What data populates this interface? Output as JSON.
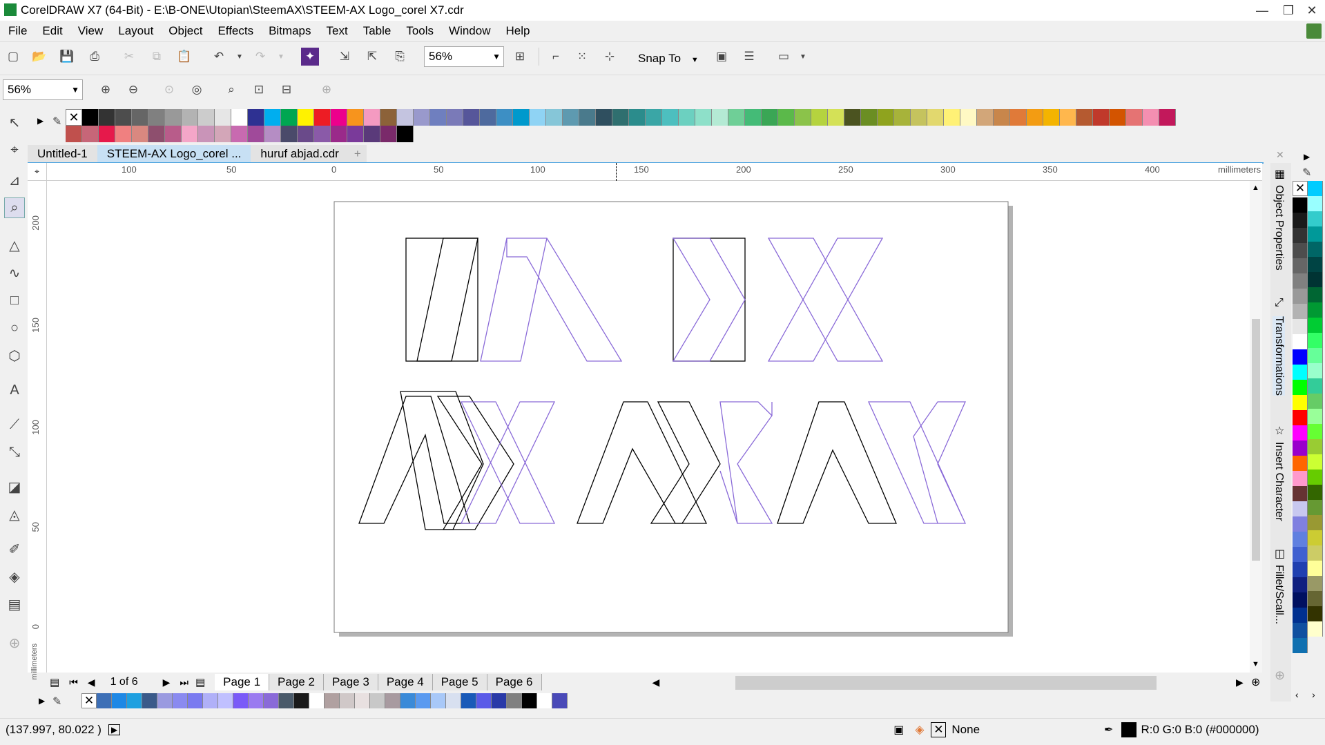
{
  "titlebar": {
    "title": "CorelDRAW X7 (64-Bit) - E:\\B-ONE\\Utopian\\SteemAX\\STEEM-AX Logo_corel X7.cdr",
    "minimize": "—",
    "restore": "❐",
    "close": "✕"
  },
  "menu": [
    "File",
    "Edit",
    "View",
    "Layout",
    "Object",
    "Effects",
    "Bitmaps",
    "Text",
    "Table",
    "Tools",
    "Window",
    "Help"
  ],
  "toolbar1": {
    "zoom_value": "56%",
    "snap_label": "Snap To"
  },
  "toolbar2": {
    "zoom_value": "56%"
  },
  "doc_tabs": [
    "Untitled-1",
    "STEEM-AX Logo_corel ...",
    "huruf abjad.cdr"
  ],
  "ruler_h": {
    "unit": "millimeters",
    "ticks": [
      "100",
      "50",
      "0",
      "50",
      "100",
      "150",
      "200",
      "250",
      "300",
      "350",
      "400"
    ]
  },
  "ruler_v": {
    "unit": "millimeters",
    "ticks": [
      "200",
      "150",
      "100",
      "50",
      "0"
    ]
  },
  "page_nav": {
    "counter": "1 of 6",
    "pages": [
      "Page 1",
      "Page 2",
      "Page 3",
      "Page 4",
      "Page 5",
      "Page 6"
    ]
  },
  "status": {
    "coords": "(137.997, 80.022 )",
    "fill_label": "None",
    "outline_label": "R:0 G:0 B:0 (#000000)"
  },
  "dockers": [
    "Object Properties",
    "Transformations",
    "Insert Character",
    "Fillet/Scall..."
  ],
  "colors": {
    "top_row1": [
      "#000000",
      "#333333",
      "#4d4d4d",
      "#666666",
      "#808080",
      "#999999",
      "#b3b3b3",
      "#cccccc",
      "#e6e6e6",
      "#ffffff",
      "#2e3192",
      "#00aeef",
      "#00a651",
      "#fff200",
      "#ed1c24",
      "#ec008c",
      "#f7941d",
      "#f49ac1",
      "#8c6239",
      "#c4c4e0",
      "#9999cc",
      "#6f7fbf",
      "#7a7ab8",
      "#56569a",
      "#4e6a9e",
      "#3d8fc4",
      "#0099cc",
      "#8fd3f4",
      "#86c6d8",
      "#5e9ab0",
      "#4a7a8c",
      "#2f4f5f",
      "#2f6f6f",
      "#2b8c8c",
      "#3aa6a6",
      "#4dbfbf",
      "#6cd0c0",
      "#8ee0c9",
      "#b4ead4",
      "#6fcf97",
      "#44bb77",
      "#3aa655",
      "#5bb94a",
      "#8bc34a",
      "#b5d33f",
      "#d4e157",
      "#4b5320",
      "#6b8e23",
      "#8fa31e",
      "#a7b33a",
      "#c5c35e",
      "#e2d86e",
      "#fff176",
      "#fff9c4",
      "#d2a679",
      "#c8864b",
      "#e07a39",
      "#f39c12",
      "#f4b400",
      "#ffb74d",
      "#b55a30",
      "#c0392b",
      "#d35400",
      "#e57373",
      "#f48fb1",
      "#c2185b"
    ],
    "top_row2": [
      "#c0504d",
      "#c76678",
      "#e6194b",
      "#f08080",
      "#d98880",
      "#8e4f6e",
      "#b85c8a",
      "#f4a6c8",
      "#c994b8",
      "#d3a6b8",
      "#c86ab0",
      "#a04a9a",
      "#b58dc4",
      "#4a4a6a",
      "#6a4a8a",
      "#8a5aa8",
      "#9a2a8a",
      "#7a3a9a",
      "#5a3a7a",
      "#7a2a6a",
      "#000000"
    ],
    "bottom": [
      "#3d6fb6",
      "#1e88e5",
      "#1ea0e0",
      "#3a5a8a",
      "#9a9ae0",
      "#8a8af0",
      "#7a7af0",
      "#b0b0f8",
      "#c0c0ff",
      "#7a5af8",
      "#9a7af0",
      "#8a6ad8",
      "#4a5a6a",
      "#1a1a1a",
      "#ffffff",
      "#b0a0a0",
      "#d0c8c8",
      "#e8e0e0",
      "#c8c8c8",
      "#a89aa0",
      "#3a8ad8",
      "#5a9af0",
      "#a8c8f8",
      "#d8e0f0",
      "#1a5ab8",
      "#5a5ae8",
      "#2a3aa8",
      "#808080",
      "#000000",
      "#ffffff",
      "#4a4ab8"
    ],
    "right_col1": [
      "#000000",
      "#1a1a1a",
      "#333333",
      "#4d4d4d",
      "#666666",
      "#808080",
      "#999999",
      "#b3b3b3",
      "#e6e6e6",
      "#ffffff",
      "#0000ff",
      "#00ffff",
      "#00ff00",
      "#ffff00",
      "#ff0000",
      "#ff00ff",
      "#9900cc",
      "#ff6600",
      "#ff99cc",
      "#663333",
      "#c8c8f0",
      "#8080e0",
      "#6080e0",
      "#4060d0",
      "#2040b0",
      "#102080",
      "#001060",
      "#003090",
      "#1050a0",
      "#1070b0"
    ],
    "right_col2": [
      "#00ccff",
      "#99ffff",
      "#33cccc",
      "#009999",
      "#006666",
      "#004444",
      "#003333",
      "#006633",
      "#009933",
      "#00cc33",
      "#33ff66",
      "#66ff99",
      "#99ffcc",
      "#33cc99",
      "#66cc66",
      "#99ff99",
      "#66ff33",
      "#99cc33",
      "#ccff33",
      "#66cc00",
      "#336600",
      "#669933",
      "#999933",
      "#cccc33",
      "#cccc66",
      "#ffff99",
      "#999966",
      "#666633",
      "#333300",
      "#ffffcc"
    ]
  }
}
